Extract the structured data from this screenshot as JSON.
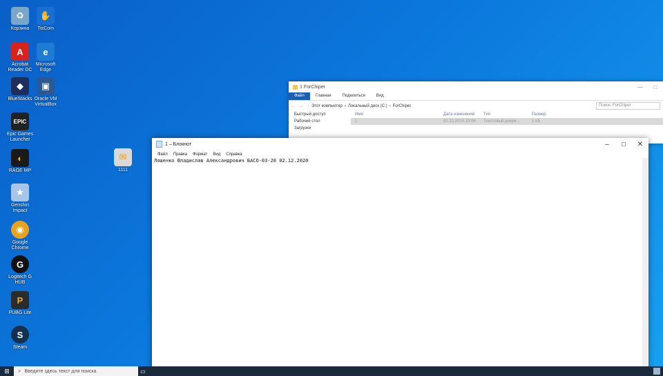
{
  "desktop": {
    "icons": [
      {
        "name": "recycle-bin-icon",
        "label": "Корзина",
        "glyph": "♻",
        "color": "#7aa6c8"
      },
      {
        "name": "tixcom-icon",
        "label": "TixCom",
        "glyph": "✋",
        "color": "#1a6fd0"
      },
      {
        "name": "acrobat-icon",
        "label": "Acrobat Reader DC",
        "glyph": "A",
        "color": "#d8231c"
      },
      {
        "name": "edge-icon",
        "label": "Microsoft Edge",
        "glyph": "e",
        "color": "#1d7bd4"
      },
      {
        "name": "bluestacks-icon",
        "label": "BlueStacks",
        "glyph": "◆",
        "color": "#1e2d5a"
      },
      {
        "name": "virtualbox-icon",
        "label": "Oracle VM VirtualBox",
        "glyph": "▣",
        "color": "#2a5a94"
      },
      {
        "name": "epic-icon",
        "label": "Epic Games Launcher",
        "glyph": "EPIC",
        "color": "#222"
      },
      {
        "name": "app-icon-1",
        "label": "RAGE MP",
        "glyph": "◐",
        "color": "#1a1a1a"
      },
      {
        "name": "note-icon",
        "label": "1111",
        "glyph": "✉",
        "color": "#c9c9c9"
      },
      {
        "name": "genshin-icon",
        "label": "Genshin Impact",
        "glyph": "★",
        "color": "#a8c5e8"
      },
      {
        "name": "chrome-icon",
        "label": "Google Chrome",
        "glyph": "◉",
        "color": "#e8a21c"
      },
      {
        "name": "logitech-icon",
        "label": "Logitech G HUB",
        "glyph": "G",
        "color": "#111"
      },
      {
        "name": "pubg-icon",
        "label": "PUBG Lite",
        "glyph": "P",
        "color": "#2b2b2b"
      },
      {
        "name": "steam-icon",
        "label": "Steam",
        "glyph": "S",
        "color": "#14304e"
      }
    ]
  },
  "explorer": {
    "title": "1 ForChiper",
    "tabs": [
      "Файл",
      "Главная",
      "Поделиться",
      "Вид"
    ],
    "path": [
      "Этот компьютер",
      "Локальный диск (C:)",
      "ForChiper"
    ],
    "search_placeholder": "Поиск: ForChiper",
    "nav": [
      "Быстрый доступ",
      "Рабочий стол",
      "Загрузки"
    ],
    "columns": [
      "Имя",
      "Дата изменения",
      "Тип",
      "Размер"
    ],
    "rows": [
      {
        "name": "1",
        "date": "02.12.2020 23:04",
        "type": "Текстовый докум...",
        "size": "1 КБ"
      }
    ],
    "buttons": {
      "minimize": "—",
      "maximize": "□"
    }
  },
  "notepad": {
    "title": "1 – Блокнот",
    "menu": [
      "Файл",
      "Правка",
      "Формат",
      "Вид",
      "Справка"
    ],
    "content": "Ляшенко Владислав Александрович БАСО-03-20 02.12.2020",
    "buttons": {
      "minimize": "–",
      "maximize": "□",
      "close": "✕"
    }
  },
  "taskbar": {
    "search_placeholder": "Введите здесь текст для поиска"
  }
}
